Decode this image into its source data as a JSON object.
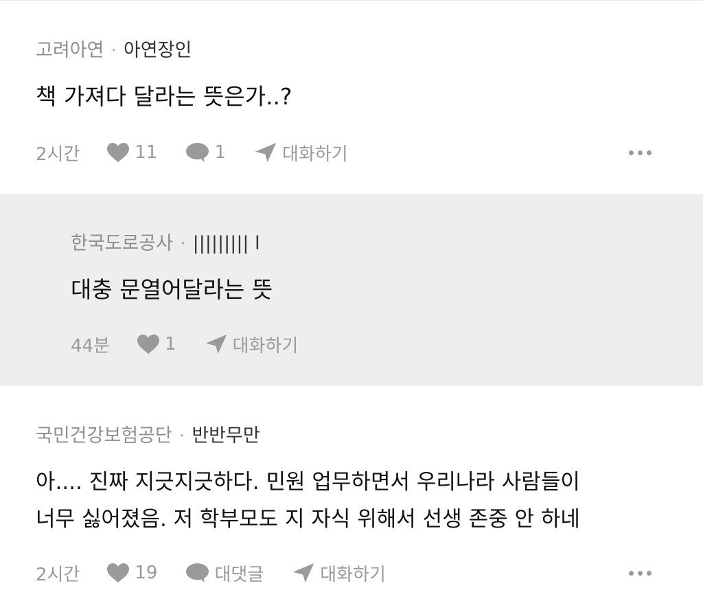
{
  "comments": [
    {
      "company": "고려아연",
      "separator": "·",
      "nickname": "아연장인",
      "text_lines": [
        "책 가져다 달라는 뜻은가..?"
      ],
      "time": "2시간",
      "likes": "11",
      "replies": "1",
      "chat_label": "대화하기"
    },
    {
      "company": "한국도로공사",
      "separator": "·",
      "nickname": "||||||||| l",
      "text_lines": [
        "대충 문열어달라는 뜻"
      ],
      "time": "44분",
      "likes": "1",
      "chat_label": "대화하기"
    },
    {
      "company": "국민건강보험공단",
      "separator": "·",
      "nickname": "반반무만",
      "text_lines": [
        "아.... 진짜 지긋지긋하다. 민원 업무하면서 우리나라 사람들이",
        "너무 싫어졌음. 저 학부모도 지 자식 위해서 선생 존중 안 하네"
      ],
      "time": "2시간",
      "likes": "19",
      "reply_label": "대댓글",
      "chat_label": "대화하기"
    }
  ],
  "icons": {
    "like": "heart-icon",
    "comment": "speech-bubble-icon",
    "chat": "paper-plane-icon",
    "more": "more-dots-icon"
  },
  "colors": {
    "background": "#ffffff",
    "reply_background": "#eeeeee",
    "meta_text": "#8e8e8e",
    "body_text": "#111111",
    "icon": "#9a9a9a"
  }
}
